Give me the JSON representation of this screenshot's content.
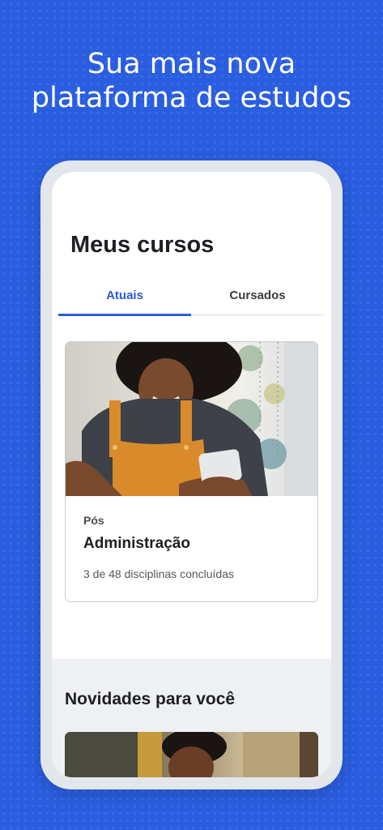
{
  "headline": {
    "line1": "Sua mais nova",
    "line2": "plataforma de estudos"
  },
  "screen": {
    "title": "Meus cursos",
    "tabs": [
      {
        "label": "Atuais",
        "active": true
      },
      {
        "label": "Cursados",
        "active": false
      }
    ],
    "course": {
      "level": "Pós",
      "name": "Administração",
      "progress": "3 de 48 disciplinas concluídas"
    },
    "news": {
      "title": "Novidades para você"
    }
  },
  "colors": {
    "background": "#2a5ee0",
    "accent": "#2a5bd0"
  }
}
